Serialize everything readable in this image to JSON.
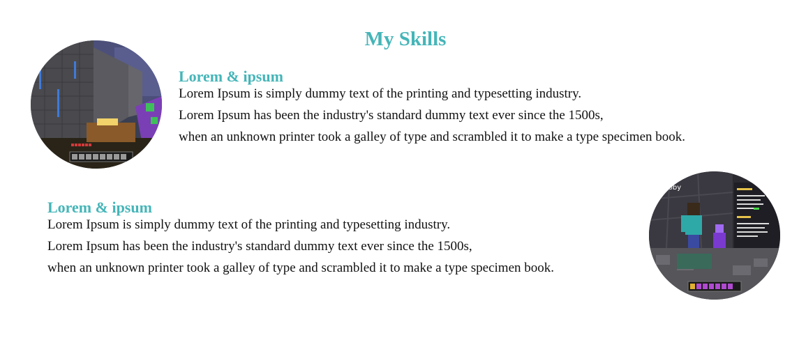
{
  "page": {
    "title": "My Skills"
  },
  "skills": [
    {
      "heading": "Lorem & ipsum",
      "lines": [
        "Lorem Ipsum is simply dummy text of the printing and typesetting industry.",
        "Lorem Ipsum has been the industry's standard dummy text ever since the 1500s,",
        "when an unknown printer took a galley of type and scrambled it to make a type specimen book."
      ],
      "image": {
        "subject": "castle-screenshot",
        "accent": "#4a6fa5"
      }
    },
    {
      "heading": "Lorem & ipsum",
      "lines": [
        "Lorem Ipsum is simply dummy text of the printing and typesetting industry.",
        "Lorem Ipsum has been the industry's standard dummy text ever since the 1500s,",
        "when an unknown printer took a galley of type and scrambled it to make a type specimen book."
      ],
      "image": {
        "subject": "lobby-screenshot",
        "caption": "Lobby",
        "accent": "#6a3fb0"
      }
    }
  ],
  "colors": {
    "accent": "#45b5b8",
    "text": "#111111",
    "background": "#ffffff"
  }
}
